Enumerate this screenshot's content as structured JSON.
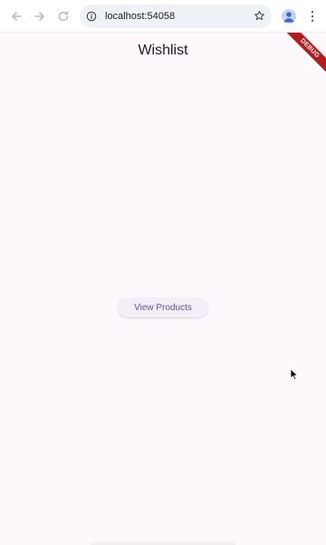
{
  "browser": {
    "url": "localhost:54058",
    "back_icon": "arrow-back-icon",
    "forward_icon": "arrow-forward-icon",
    "reload_icon": "reload-icon",
    "info_icon": "info-icon",
    "bookmark_icon": "star-icon",
    "profile_icon": "account-icon",
    "menu_icon": "kebab-menu-icon"
  },
  "app": {
    "title": "Wishlist",
    "debug_banner": "DEBUG",
    "view_products_label": "View Products"
  },
  "colors": {
    "background": "#fcf8fc",
    "button_text": "#65558f",
    "debug_banner": "#b71c1c"
  }
}
